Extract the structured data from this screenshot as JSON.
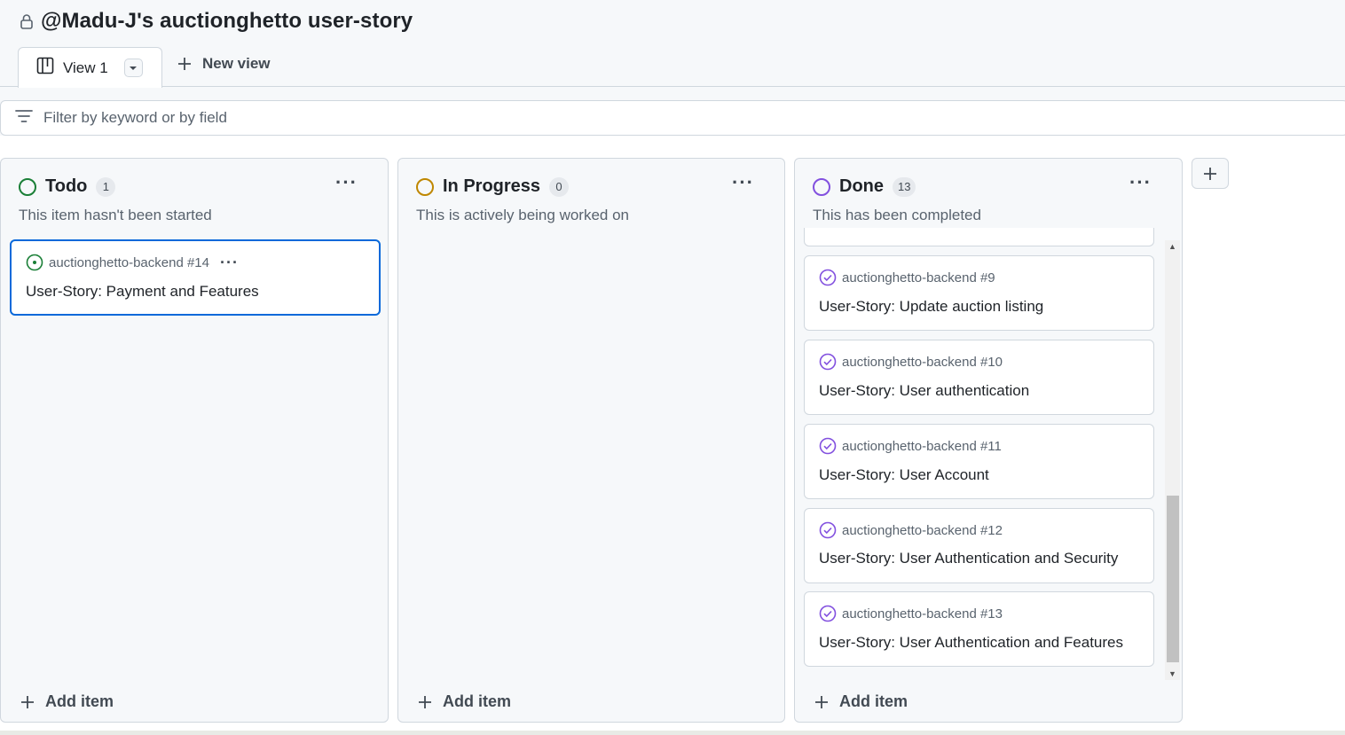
{
  "header": {
    "title": "@Madu-J's auctionghetto user-story",
    "tabs": [
      {
        "label": "View 1"
      }
    ],
    "new_view_label": "New view"
  },
  "filter": {
    "placeholder": "Filter by keyword or by field"
  },
  "columns": [
    {
      "name": "Todo",
      "count": "1",
      "description": "This item hasn't been started",
      "status_color": "#1a7f37",
      "add_item_label": "Add item",
      "cards": [
        {
          "repo": "auctionghetto-backend #14",
          "title": "User-Story: Payment and Features"
        }
      ]
    },
    {
      "name": "In Progress",
      "count": "0",
      "description": "This is actively being worked on",
      "status_color": "#bf8700",
      "add_item_label": "Add item",
      "cards": []
    },
    {
      "name": "Done",
      "count": "13",
      "description": "This has been completed",
      "status_color": "#8250df",
      "add_item_label": "Add item",
      "cards": [
        {
          "repo": "auctionghetto-backend #9",
          "title": "User-Story: Update auction listing"
        },
        {
          "repo": "auctionghetto-backend #10",
          "title": "User-Story: User authentication"
        },
        {
          "repo": "auctionghetto-backend #11",
          "title": "User-Story: User Account"
        },
        {
          "repo": "auctionghetto-backend #12",
          "title": "User-Story: User Authentication and Security"
        },
        {
          "repo": "auctionghetto-backend #13",
          "title": "User-Story: User Authentication and Features"
        }
      ]
    }
  ],
  "colors": {
    "selected_border": "#0969da",
    "done_purple": "#8250df",
    "todo_green": "#1a7f37"
  }
}
